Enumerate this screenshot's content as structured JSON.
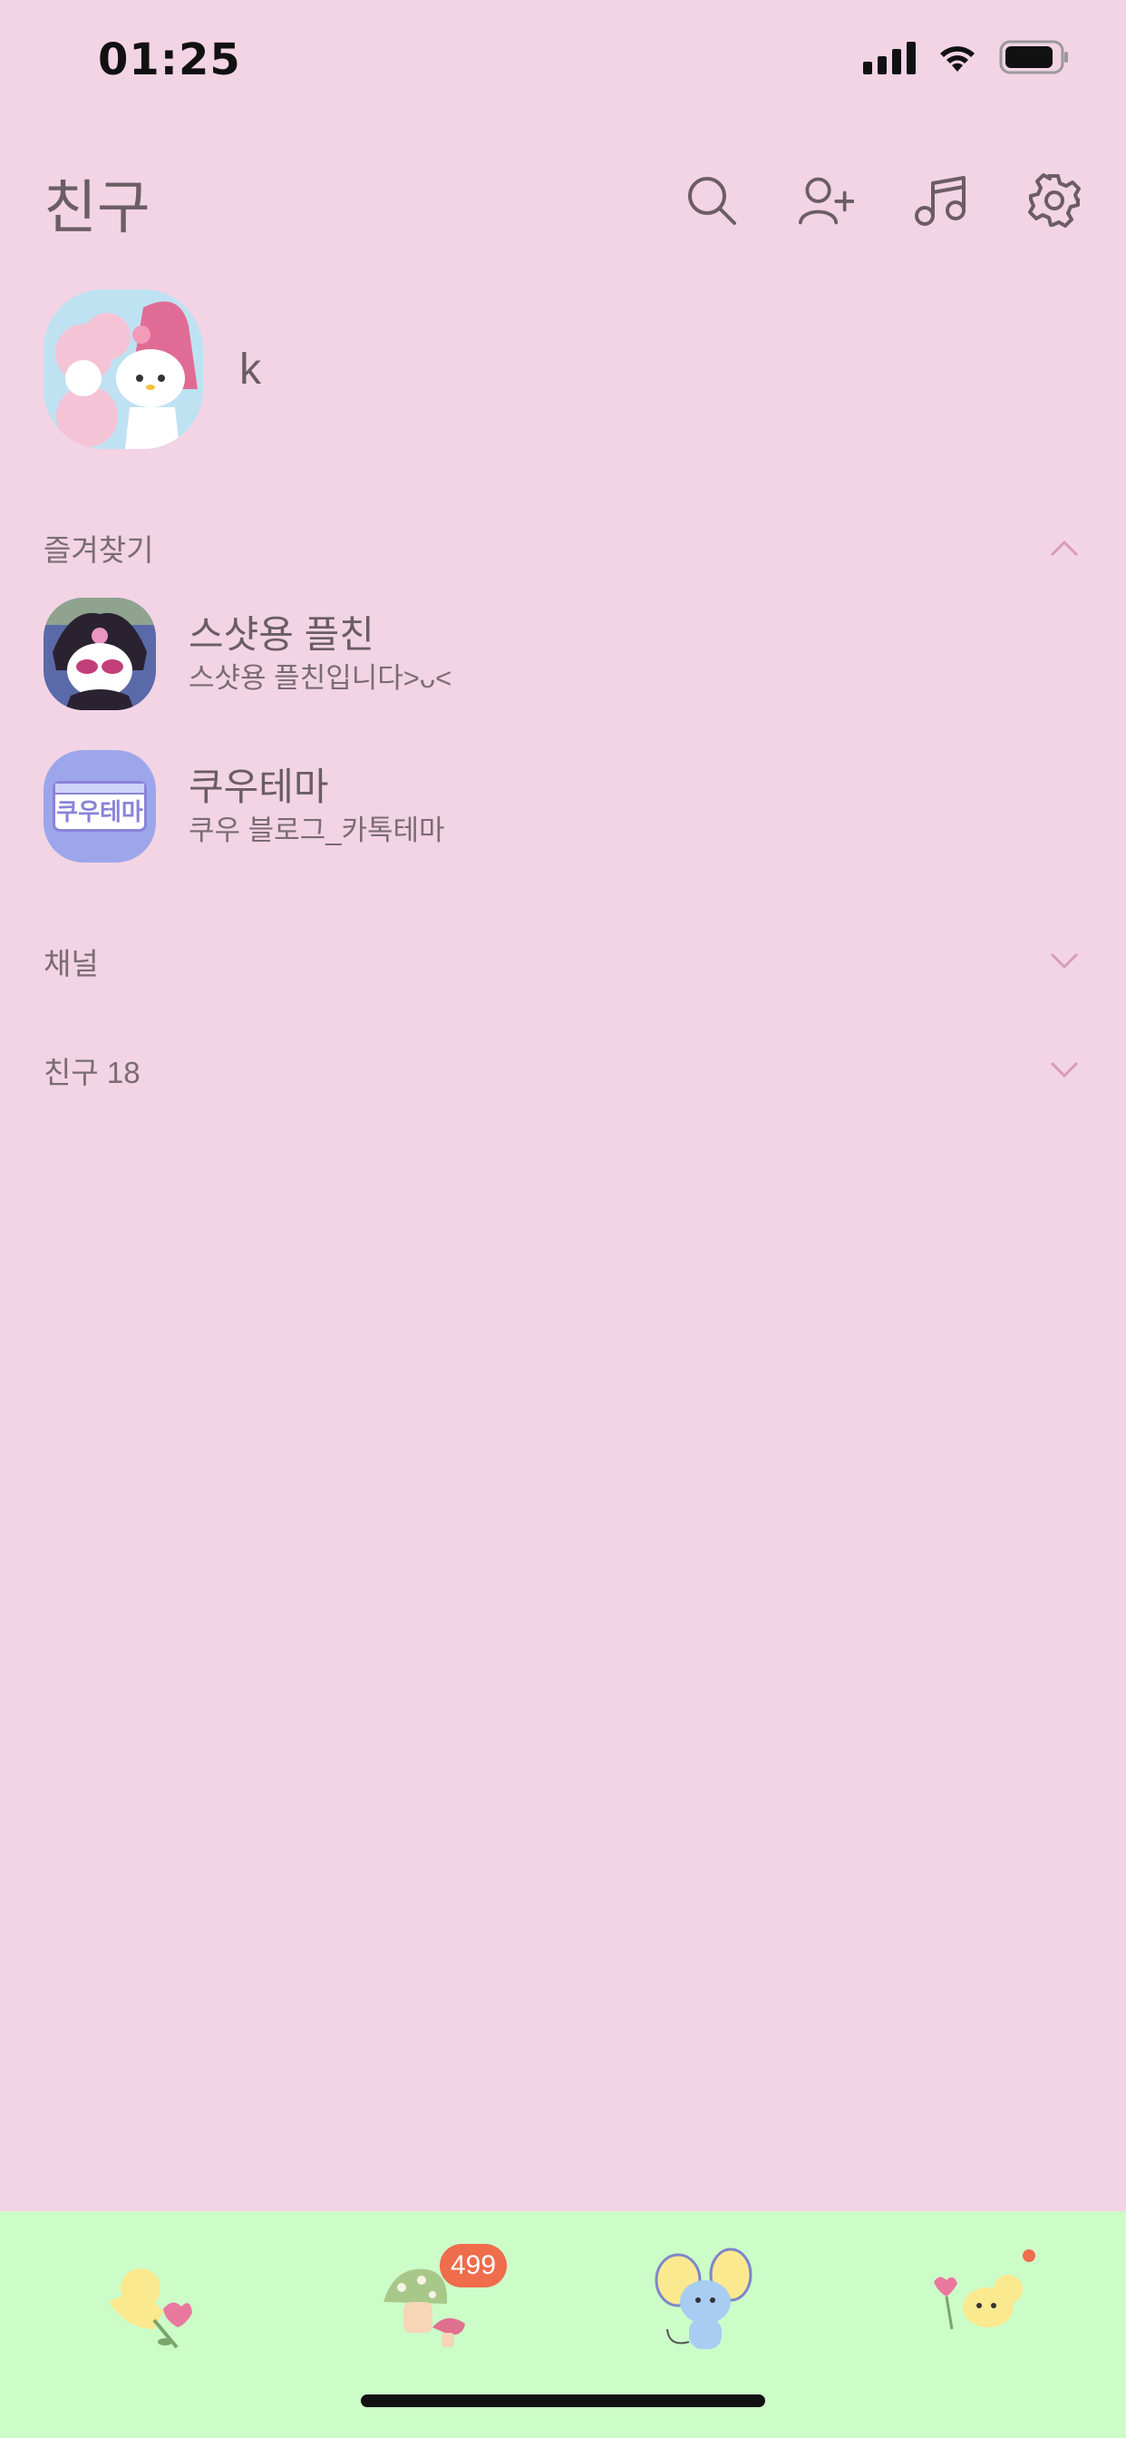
{
  "status_bar": {
    "time": "01:25"
  },
  "header": {
    "title": "친구",
    "actions": [
      "search-icon",
      "add-friend-icon",
      "music-icon",
      "settings-icon"
    ]
  },
  "profile": {
    "name": "k"
  },
  "favorites": {
    "title": "즐겨찾기",
    "items": [
      {
        "name": "스샷용 플친",
        "status": "스샷용 플친입니다>ᴗ<"
      },
      {
        "name": "쿠우테마",
        "status": "쿠우 블로그_카톡테마",
        "avatar_text": "쿠우테마"
      }
    ]
  },
  "channel": {
    "title": "채널"
  },
  "friends": {
    "title": "친구 18"
  },
  "tab_bar": {
    "chats_badge": "499",
    "tabs": [
      "friends-tab",
      "chats-tab",
      "view-tab",
      "more-tab"
    ]
  },
  "colors": {
    "background": "#f2d4e5",
    "tab_bar": "#ccfdc9",
    "text": "#6b5d63",
    "badge": "#ef6c4c"
  }
}
